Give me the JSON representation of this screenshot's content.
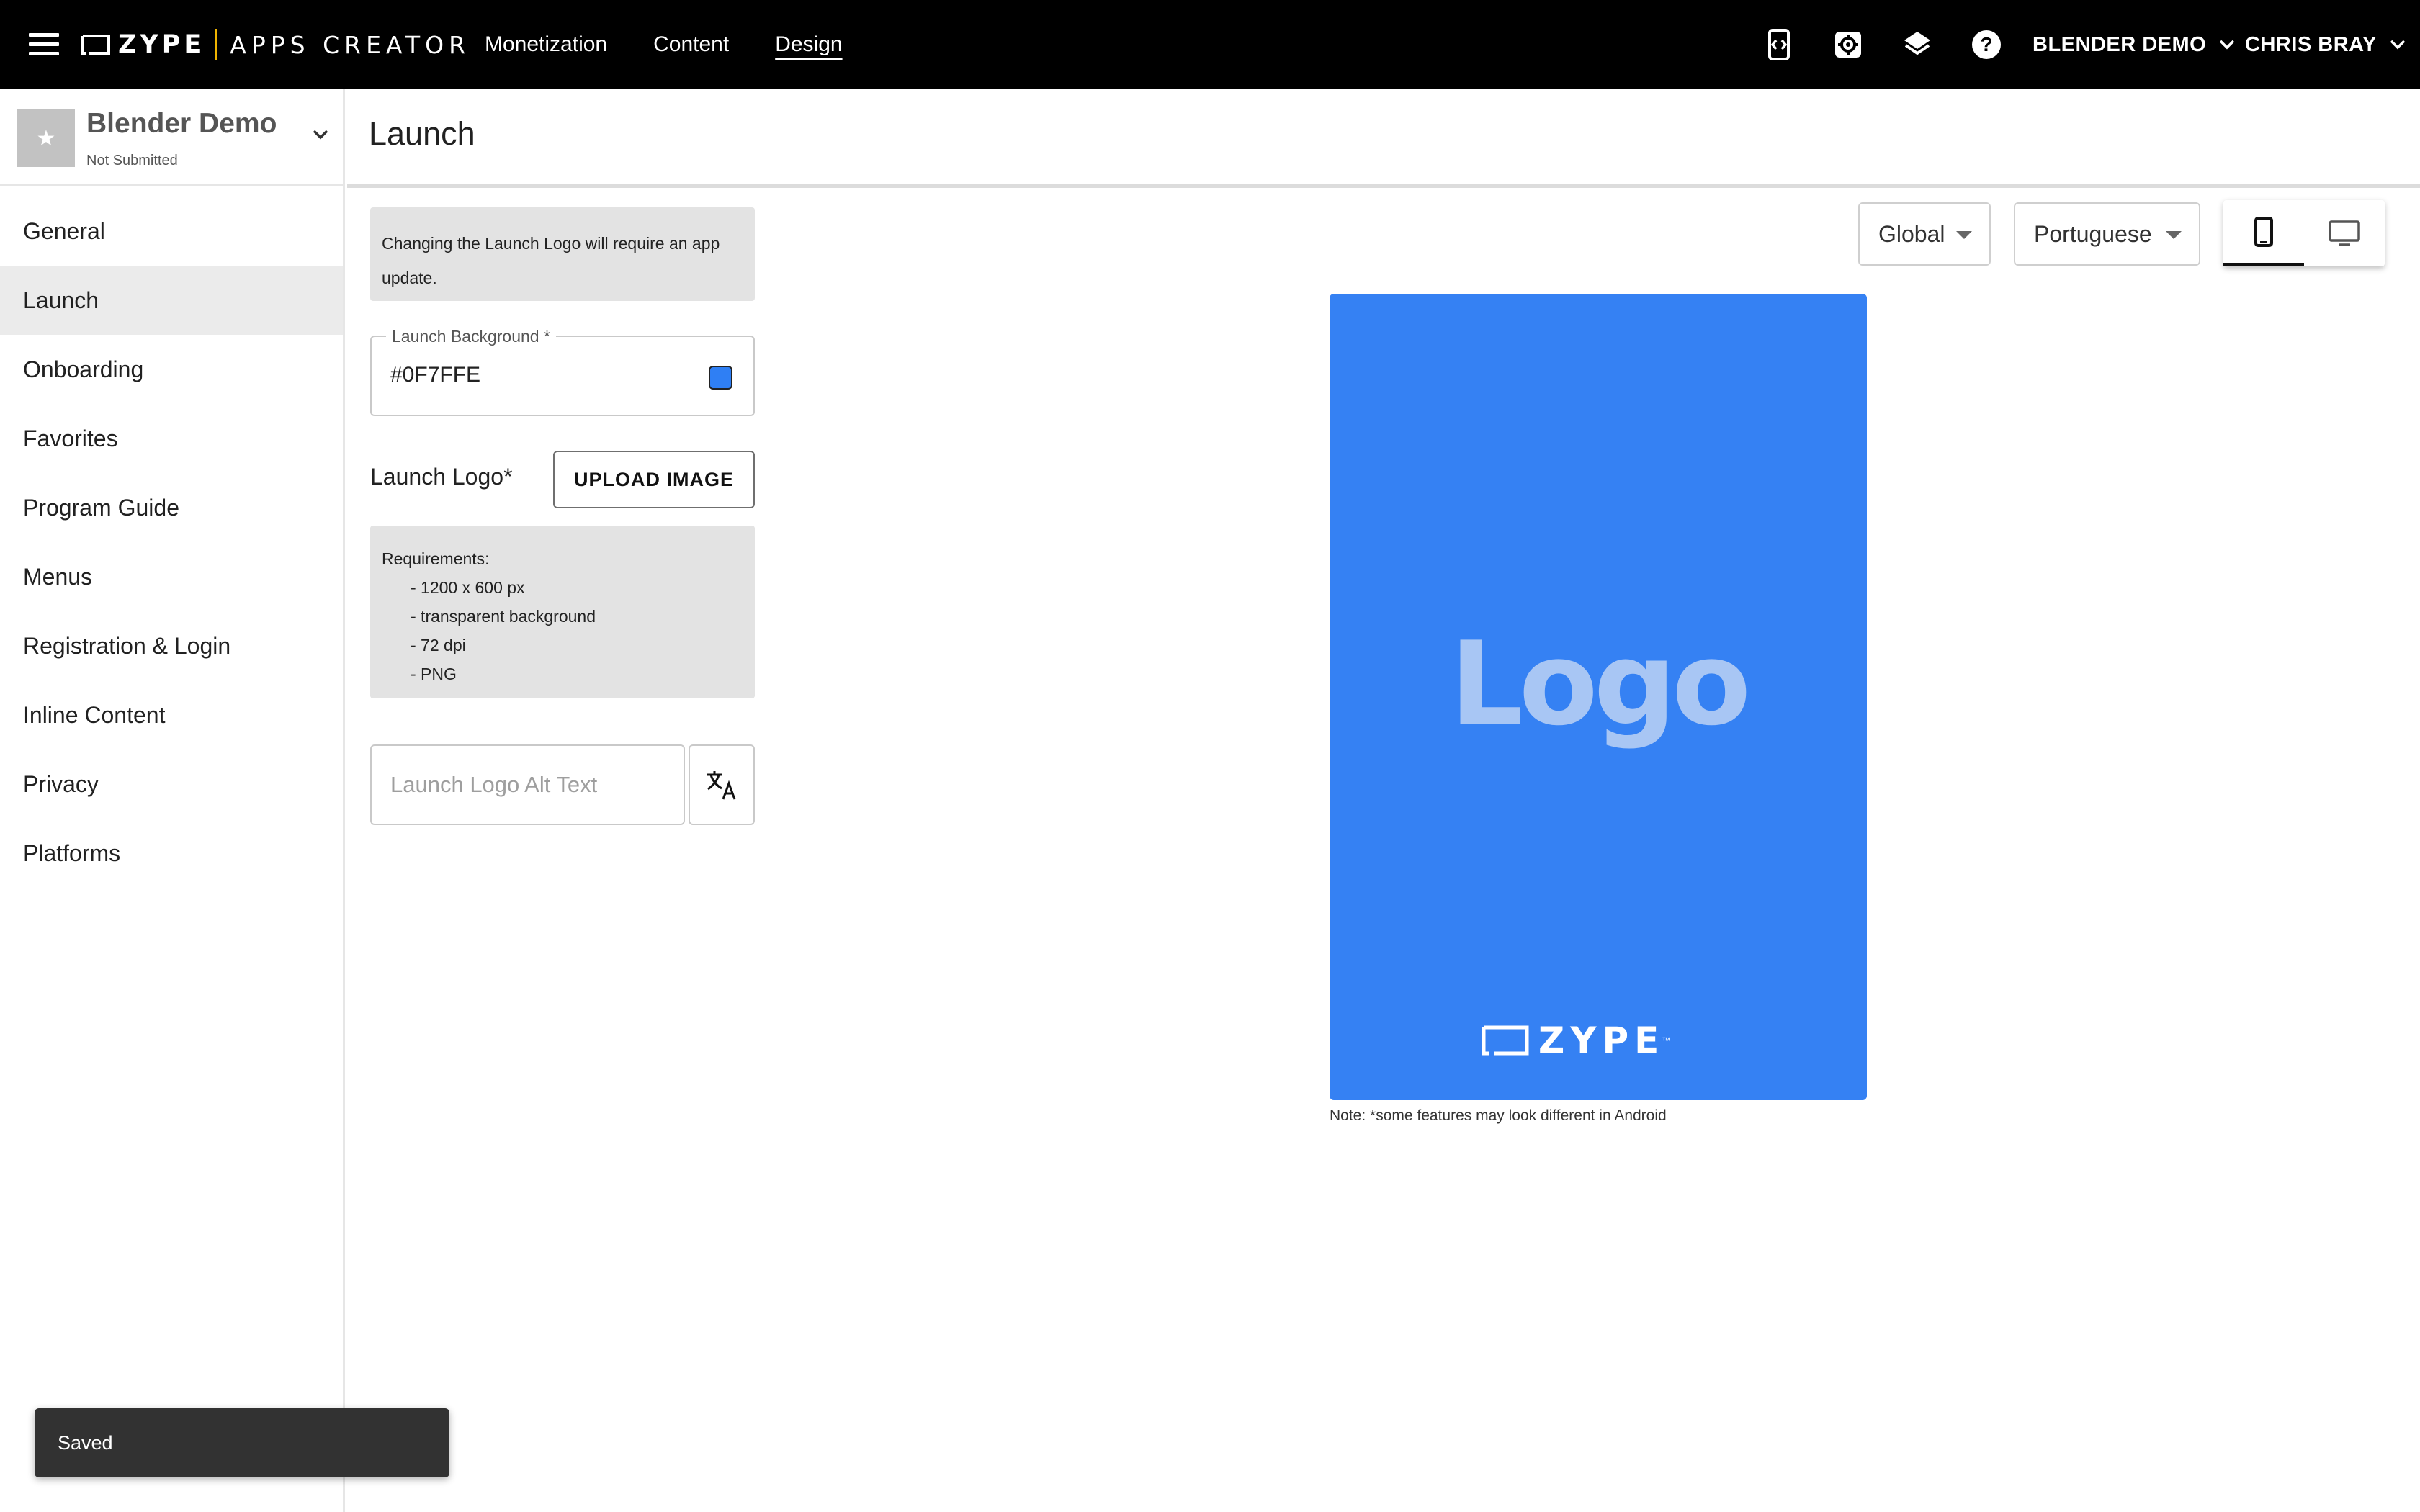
{
  "header": {
    "brand": "ZYPE",
    "product": "APPS CREATOR",
    "nav": [
      {
        "label": "Monetization"
      },
      {
        "label": "Content"
      },
      {
        "label": "Design"
      }
    ],
    "active_nav": "Design",
    "icons": [
      "code-preview-icon",
      "settings-gear-icon",
      "layers-icon",
      "help-icon"
    ],
    "app_menu": "BLENDER DEMO",
    "user_menu": "CHRIS BRAY"
  },
  "sidebar": {
    "app_name": "Blender Demo",
    "app_status": "Not Submitted",
    "thumb_icon": "★",
    "items": [
      {
        "label": "General"
      },
      {
        "label": "Launch"
      },
      {
        "label": "Onboarding"
      },
      {
        "label": "Favorites"
      },
      {
        "label": "Program Guide"
      },
      {
        "label": "Menus"
      },
      {
        "label": "Registration & Login"
      },
      {
        "label": "Inline Content"
      },
      {
        "label": "Privacy"
      },
      {
        "label": "Platforms"
      }
    ],
    "active_item": "Launch"
  },
  "page": {
    "title": "Launch"
  },
  "form": {
    "logo_update_notice": "Changing the Launch Logo will require an app update.",
    "background_label": "Launch Background *",
    "background_value": "#0F7FFE",
    "background_swatch_color": "#2f7ff4",
    "logo_label": "Launch Logo*",
    "upload_button": "UPLOAD IMAGE",
    "requirements_title": "Requirements:",
    "requirements": [
      "- 1200 x 600 px",
      "- transparent background",
      "- 72 dpi",
      "- PNG"
    ],
    "alt_text_placeholder": "Launch Logo Alt Text",
    "alt_text_value": ""
  },
  "preview_controls": {
    "scope_select": "Global",
    "language_select": "Portuguese",
    "device_modes": [
      "phone",
      "tv"
    ],
    "active_device": "phone"
  },
  "preview": {
    "background_color": "#3581f3",
    "logo_placeholder": "Logo",
    "footer_brand": "ZYPE",
    "footer_trademark": "™",
    "note": "Note: *some features may look different in Android"
  },
  "snackbar": {
    "message": "Saved"
  },
  "colors": {
    "topbar": "#000000",
    "brand_accent": "#f0b400",
    "sidebar_active": "#ebebeb",
    "info_box": "#e3e3e3"
  }
}
